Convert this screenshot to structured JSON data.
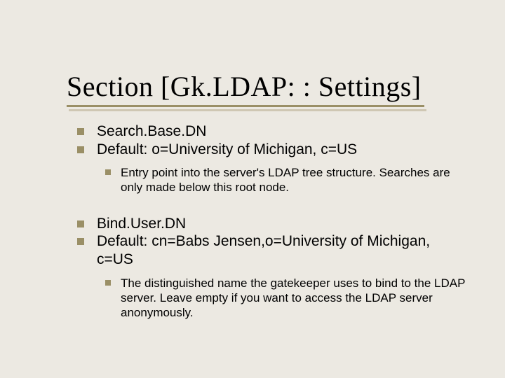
{
  "title": "Section [Gk.LDAP: : Settings]",
  "items": [
    {
      "lines": [
        "Search.Base.DN",
        "Default: o=University of Michigan, c=US"
      ],
      "sub": "Entry point into the server's LDAP tree structure. Searches are only made below this root node."
    },
    {
      "lines": [
        "Bind.User.DN",
        "Default: cn=Babs Jensen,o=University of Michigan, c=US"
      ],
      "sub": "The distinguished name the gatekeeper uses to bind to the LDAP server. Leave empty if you want to access the LDAP server anonymously."
    }
  ]
}
